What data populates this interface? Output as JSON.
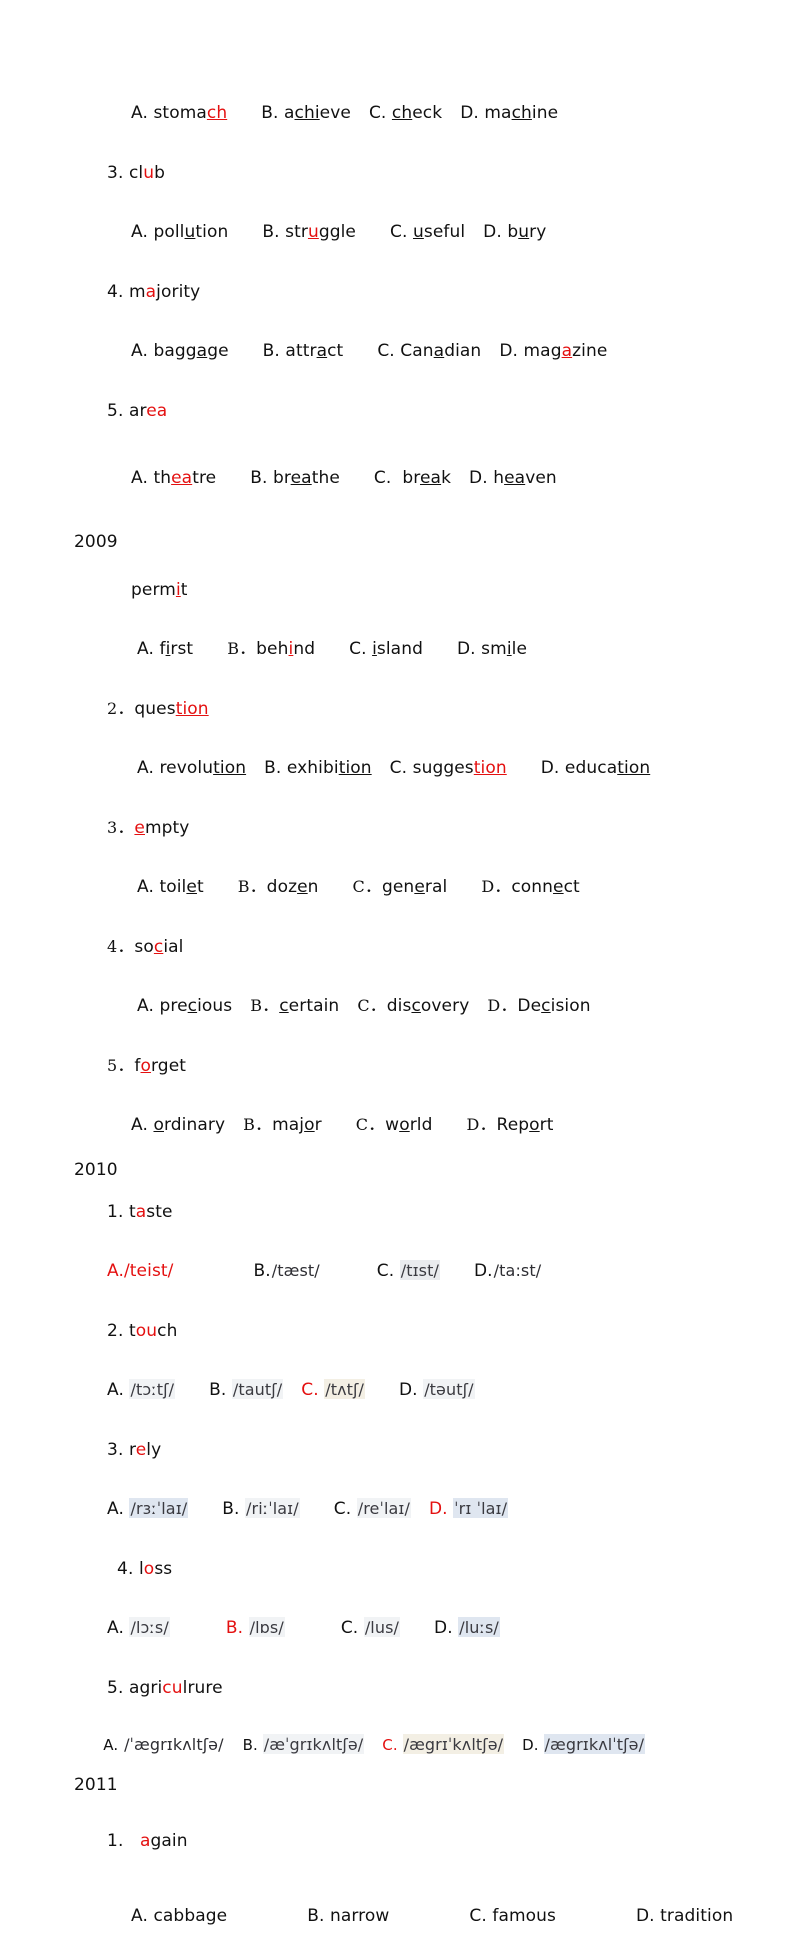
{
  "document": {
    "title": "English pronunciation practice — underlined-letter questions by year",
    "accent_red": "#e41010",
    "text_color": "#111111",
    "background": "#ffffff"
  },
  "blocks": [
    {
      "id": "block-top",
      "year_label": "",
      "items": [
        {
          "id": "item-top-2",
          "number": "",
          "stem": "",
          "options_line": [
            {
              "label": "A.",
              "word_pre": " stoma",
              "word_mark": "ch",
              "word_post": "",
              "mark_style": "red-underline"
            },
            {
              "label": "B.",
              "word_pre": " a",
              "word_mark": "chi",
              "word_post": "eve",
              "mark_style": "black-underline"
            },
            {
              "label": "C.",
              "word_pre": " ",
              "word_mark": "ch",
              "word_post": "eck",
              "mark_style": "black-underline"
            },
            {
              "label": "D.",
              "word_pre": " ma",
              "word_mark": "ch",
              "word_post": "ine",
              "mark_style": "black-underline"
            }
          ]
        },
        {
          "id": "item-top-3",
          "number": "3.",
          "stem_pre": " cl",
          "stem_mark": "u",
          "stem_post": "b",
          "stem_mark_style": "red",
          "options_line": [
            {
              "label": "A.",
              "word_pre": " poll",
              "word_mark": "u",
              "word_post": "tion",
              "mark_style": "black-underline"
            },
            {
              "label": "B.",
              "word_pre": " str",
              "word_mark": "u",
              "word_post": "ggle",
              "mark_style": "red-underline"
            },
            {
              "label": "C.",
              "word_pre": " ",
              "word_mark": "u",
              "word_post": "seful",
              "mark_style": "black-underline"
            },
            {
              "label": "D.",
              "word_pre": " b",
              "word_mark": "u",
              "word_post": "ry",
              "mark_style": "black-underline"
            }
          ]
        },
        {
          "id": "item-top-4",
          "number": "4.",
          "stem_pre": " m",
          "stem_mark": "a",
          "stem_post": "jority",
          "stem_mark_style": "red",
          "options_line": [
            {
              "label": "A.",
              "word_pre": " bagg",
              "word_mark": "a",
              "word_post": "ge",
              "mark_style": "black-underline"
            },
            {
              "label": "B.",
              "word_pre": " attr",
              "word_mark": "a",
              "word_post": "ct",
              "mark_style": "black-underline"
            },
            {
              "label": "C.",
              "word_pre": " Can",
              "word_mark": "a",
              "word_post": "dian",
              "mark_style": "black-underline"
            },
            {
              "label": "D.",
              "word_pre": " mag",
              "word_mark": "a",
              "word_post": "zine",
              "mark_style": "red-underline"
            }
          ]
        },
        {
          "id": "item-top-5",
          "number": "5.",
          "stem_pre": " ar",
          "stem_mark": "ea",
          "stem_post": "",
          "stem_mark_style": "red",
          "options_line": [
            {
              "label": "A.",
              "word_pre": " th",
              "word_mark": "ea",
              "word_post": "tre",
              "mark_style": "red-underline"
            },
            {
              "label": "B.",
              "word_pre": " br",
              "word_mark": "ea",
              "word_post": "the",
              "mark_style": "black-underline"
            },
            {
              "label": "C.",
              "word_pre": "  br",
              "word_mark": "ea",
              "word_post": "k",
              "mark_style": "black-underline"
            },
            {
              "label": "D.",
              "word_pre": " h",
              "word_mark": "ea",
              "word_post": "ven",
              "mark_style": "black-underline"
            }
          ]
        }
      ]
    },
    {
      "id": "block-2009",
      "year_label": "2009",
      "items": [
        {
          "id": "item-2009-1",
          "number": "",
          "stem_pre": "perm",
          "stem_mark": "i",
          "stem_post": "t",
          "stem_mark_style": "red-underline",
          "options_line": [
            {
              "label": "A.",
              "word_pre": " f",
              "word_mark": "i",
              "word_post": "rst",
              "mark_style": "black-underline"
            },
            {
              "label": "B．",
              "word_pre": " beh",
              "word_mark": "i",
              "word_post": "nd",
              "mark_style": "red-underline"
            },
            {
              "label": "C.",
              "word_pre": " ",
              "word_mark": "i",
              "word_post": "sland",
              "mark_style": "black-underline"
            },
            {
              "label": "D.",
              "word_pre": " sm",
              "word_mark": "i",
              "word_post": "le",
              "mark_style": "black-underline"
            }
          ]
        },
        {
          "id": "item-2009-2",
          "number": "2．",
          "stem_pre": " ques",
          "stem_mark": "tion",
          "stem_post": "",
          "stem_mark_style": "red-underline",
          "options_line": [
            {
              "label": "A.",
              "word_pre": " revolu",
              "word_mark": "tion",
              "word_post": "",
              "mark_style": "black-underline"
            },
            {
              "label": "B.",
              "word_pre": " exhibi",
              "word_mark": "tion",
              "word_post": "",
              "mark_style": "black-underline"
            },
            {
              "label": "C.",
              "word_pre": " sugges",
              "word_mark": "tion",
              "word_post": "",
              "mark_style": "red-underline"
            },
            {
              "label": "D.",
              "word_pre": " educa",
              "word_mark": "tion",
              "word_post": "",
              "mark_style": "black-underline"
            }
          ]
        },
        {
          "id": "item-2009-3",
          "number": "3．",
          "stem_pre": " ",
          "stem_mark": "e",
          "stem_post": "mpty",
          "stem_mark_style": "red-underline",
          "options_line": [
            {
              "label": "A.",
              "word_pre": " toil",
              "word_mark": "e",
              "word_post": "t",
              "mark_style": "black-underline"
            },
            {
              "label": "B．",
              "word_pre": " doz",
              "word_mark": "e",
              "word_post": "n",
              "mark_style": "black-underline"
            },
            {
              "label": "C．",
              "word_pre": " gen",
              "word_mark": "e",
              "word_post": "ral",
              "mark_style": "black-underline"
            },
            {
              "label": "D．",
              "word_pre": " conn",
              "word_mark": "e",
              "word_post": "ct",
              "mark_style": "black-underline"
            }
          ]
        },
        {
          "id": "item-2009-4",
          "number": "4．",
          "stem_pre": " so",
          "stem_mark": "c",
          "stem_post": "ial",
          "stem_mark_style": "red-underline",
          "options_line": [
            {
              "label": "A.",
              "word_pre": " pre",
              "word_mark": "c",
              "word_post": "ious",
              "mark_style": "black-underline"
            },
            {
              "label": "B．",
              "word_pre": " ",
              "word_mark": "c",
              "word_post": "ertain",
              "mark_style": "black-underline"
            },
            {
              "label": "C．",
              "word_pre": " dis",
              "word_mark": "c",
              "word_post": "overy",
              "mark_style": "black-underline"
            },
            {
              "label": "D．",
              "word_pre": " De",
              "word_mark": "c",
              "word_post": "ision",
              "mark_style": "black-underline"
            }
          ]
        },
        {
          "id": "item-2009-5",
          "number": "5．",
          "stem_pre": " f",
          "stem_mark": "o",
          "stem_post": "rget",
          "stem_mark_style": "red-underline",
          "options_line": [
            {
              "label": "A.",
              "word_pre": " ",
              "word_mark": "o",
              "word_post": "rdinary",
              "mark_style": "black-underline"
            },
            {
              "label": "B．",
              "word_pre": " maj",
              "word_mark": "o",
              "word_post": "r",
              "mark_style": "black-underline"
            },
            {
              "label": "C．",
              "word_pre": " w",
              "word_mark": "o",
              "word_post": "rld",
              "mark_style": "black-underline"
            },
            {
              "label": "D．",
              "word_pre": " Rep",
              "word_mark": "o",
              "word_post": "rt",
              "mark_style": "black-underline"
            }
          ]
        }
      ]
    },
    {
      "id": "block-2010",
      "year_label": "2010",
      "items": [
        {
          "id": "item-2010-1",
          "number": "1.",
          "stem_pre": " t",
          "stem_mark": "a",
          "stem_post": "ste",
          "stem_mark_style": "red",
          "ipa_options": [
            {
              "label": "A.",
              "ipa": "/teist/",
              "style": "red"
            },
            {
              "label": "B.",
              "ipa": "/tæst/",
              "style": "plain"
            },
            {
              "label": "C.",
              "ipa": "/tɪst/",
              "style": "tint-gray"
            },
            {
              "label": "D.",
              "ipa": "/ta:st/",
              "style": "plain"
            }
          ]
        },
        {
          "id": "item-2010-2",
          "number": "2.",
          "stem_pre": " t",
          "stem_mark": "ou",
          "stem_post": "ch",
          "stem_mark_style": "red",
          "ipa_options": [
            {
              "label": "A.",
              "ipa": "/tɔːtʃ/",
              "style": "tint-faint"
            },
            {
              "label": "B.",
              "ipa": "/tautʃ/",
              "style": "tint-faint"
            },
            {
              "label": "C.",
              "ipa": "/tʌtʃ/",
              "style": "tint-cream",
              "label_style": "red"
            },
            {
              "label": "D.",
              "ipa": "/təutʃ/",
              "style": "tint-faint"
            }
          ]
        },
        {
          "id": "item-2010-3",
          "number": "3.",
          "stem_pre": " r",
          "stem_mark": "e",
          "stem_post": "ly",
          "stem_mark_style": "red",
          "ipa_options": [
            {
              "label": "A.",
              "ipa": "/rɜːˈlaɪ/",
              "style": "tint-blue"
            },
            {
              "label": "B.",
              "ipa": "/riːˈlaɪ/",
              "style": "tint-faint"
            },
            {
              "label": "C.",
              "ipa": "/reˈlaɪ/",
              "style": "tint-faint"
            },
            {
              "label": "D.",
              "ipa": "ˈrɪ ˈlaɪ/",
              "style": "tint-blue",
              "label_style": "red"
            }
          ]
        },
        {
          "id": "item-2010-4",
          "number": " 4.",
          "stem_pre": " l",
          "stem_mark": "o",
          "stem_post": "ss",
          "stem_mark_style": "red",
          "ipa_options": [
            {
              "label": "A.",
              "ipa": "/lɔːs/",
              "style": "tint-faint"
            },
            {
              "label": "B.",
              "ipa": "/lɒs/",
              "style": "tint-faint",
              "label_style": "red"
            },
            {
              "label": "C.",
              "ipa": "/lus/",
              "style": "tint-faint"
            },
            {
              "label": "D.",
              "ipa": "/luːs/",
              "style": "tint-blue"
            }
          ]
        },
        {
          "id": "item-2010-5",
          "number": "5.",
          "stem_pre": " agri",
          "stem_mark": "cu",
          "stem_post": "lrure",
          "stem_mark_style": "red",
          "ipa_options": [
            {
              "label": "A.",
              "ipa": "/ˈægrɪkʌltʃə/",
              "style": "plain"
            },
            {
              "label": "B.",
              "ipa": "/æˈgrɪkʌltʃə/",
              "style": "tint-faint"
            },
            {
              "label": "C.",
              "ipa": "/ægrɪˈkʌltʃə/",
              "style": "tint-cream",
              "label_style": "red"
            },
            {
              "label": "D.",
              "ipa": "/ægrɪkʌlˈtʃə/",
              "style": "tint-blue"
            }
          ]
        }
      ]
    },
    {
      "id": "block-2011",
      "year_label": "2011",
      "items": [
        {
          "id": "item-2011-1",
          "number": "1.",
          "stem_pre": "   ",
          "stem_mark": "a",
          "stem_post": "gain",
          "stem_mark_style": "red",
          "options_line": [
            {
              "label": "A.",
              "word_pre": " cabbage",
              "word_mark": "",
              "word_post": "",
              "mark_style": "none"
            },
            {
              "label": "B.",
              "word_pre": " narrow",
              "word_mark": "",
              "word_post": "",
              "mark_style": "none"
            },
            {
              "label": "C.",
              "word_pre": " famous",
              "word_mark": "",
              "word_post": "",
              "mark_style": "none"
            },
            {
              "label": "D.",
              "word_pre": " tradition",
              "word_mark": "",
              "word_post": "",
              "mark_style": "none"
            }
          ]
        }
      ]
    }
  ],
  "lines": {
    "top_opt_2": "A. stomach    B. achieve    C. check    D. machine",
    "top_q3": "3. club",
    "top_opt_3": "A. pollution    B. struggle    C. useful    D. bury",
    "top_q4": "4. majority",
    "top_opt_4": "A. baggage    B. attract    C. Canadian    D. magazine",
    "top_q5": "5. area",
    "top_opt_5": "A. theatre    B. breathe    C.  break    D. heaven"
  }
}
